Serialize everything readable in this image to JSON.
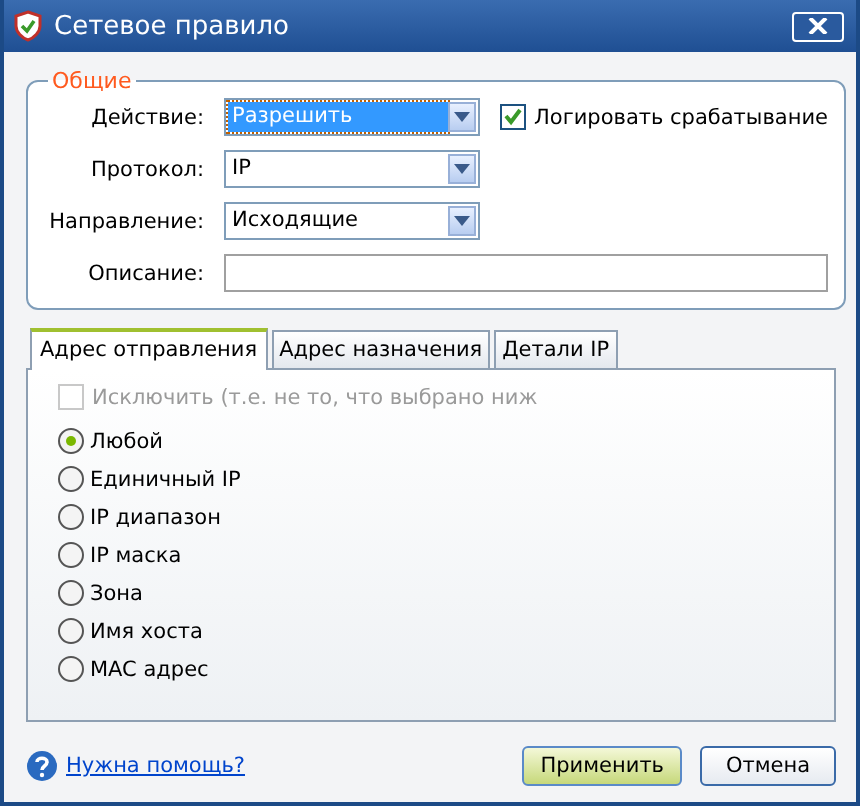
{
  "window": {
    "title": "Сетевое правило"
  },
  "general": {
    "title": "Общие",
    "action": {
      "label": "Действие:",
      "value": "Разрешить",
      "highlighted": true
    },
    "log": {
      "label": "Логировать срабатывание",
      "checked": true
    },
    "protocol": {
      "label": "Протокол:",
      "value": "IP"
    },
    "direction": {
      "label": "Направление:",
      "value": "Исходящие"
    },
    "description": {
      "label": "Описание:"
    }
  },
  "tabs": [
    {
      "label": "Адрес отправления",
      "selected": true
    },
    {
      "label": "Адрес назначения",
      "selected": false
    },
    {
      "label": "Детали IP",
      "selected": false
    }
  ],
  "exclude": {
    "label": "Исключить (т.е. не то, что выбрано ниж",
    "checked": false,
    "disabled": true
  },
  "options": [
    {
      "label": "Любой",
      "selected": true
    },
    {
      "label": "Единичный IP",
      "selected": false
    },
    {
      "label": "IP диапазон",
      "selected": false
    },
    {
      "label": "IP маска",
      "selected": false
    },
    {
      "label": "Зона",
      "selected": false
    },
    {
      "label": "Имя хоста",
      "selected": false
    },
    {
      "label": "MAC адрес",
      "selected": false
    }
  ],
  "help_link": "Нужна помощь?",
  "buttons": [
    {
      "label": "Применить",
      "kind": "primary"
    },
    {
      "label": "Отмена",
      "kind": "normal"
    }
  ]
}
